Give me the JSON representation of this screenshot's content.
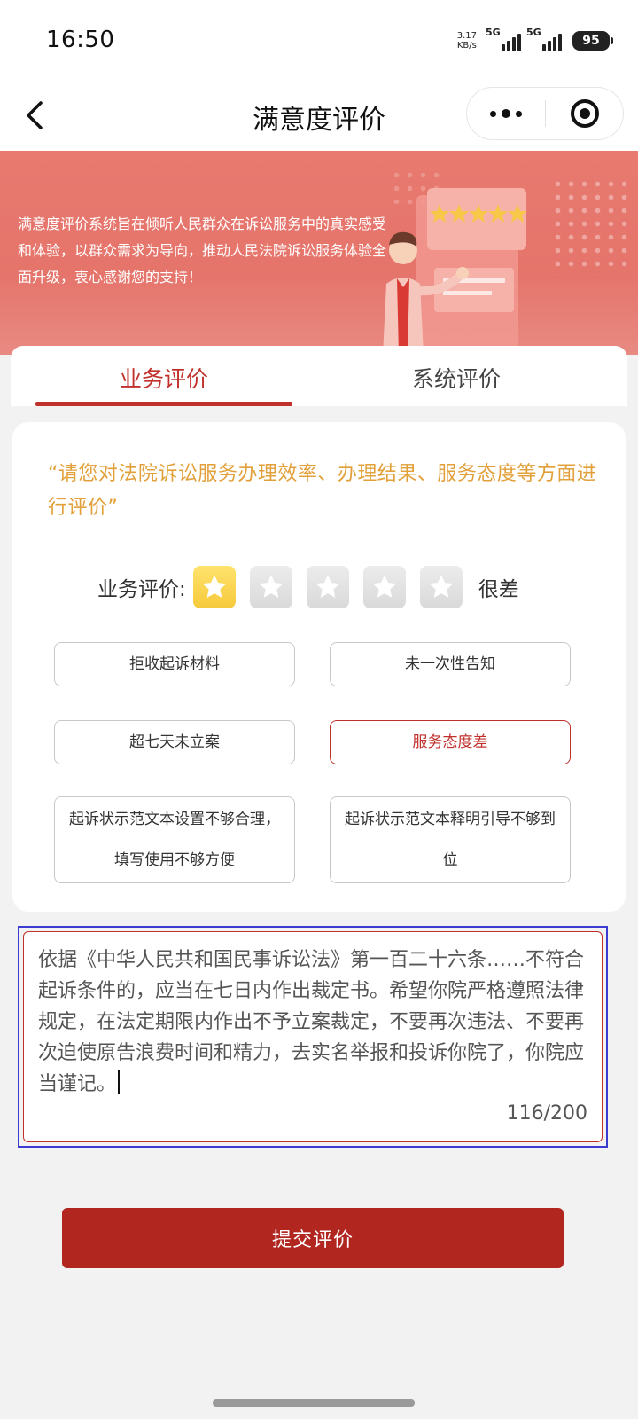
{
  "status_bar": {
    "time": "16:50",
    "net_speed_value": "3.17",
    "net_speed_unit": "KB/s",
    "sim1_label": "5G",
    "sim2_label": "5G",
    "battery": "95"
  },
  "nav": {
    "title": "满意度评价",
    "back_icon": "chevron-left-icon",
    "more_icon": "more-dots-icon",
    "close_icon": "target-circle-icon"
  },
  "banner": {
    "text": "满意度评价系统旨在倾听人民群众在诉讼服务中的真实感受和体验，以群众需求为导向，推动人民法院诉讼服务体验全面升级，衷心感谢您的支持！"
  },
  "tabs": [
    {
      "label": "业务评价",
      "active": true
    },
    {
      "label": "系统评价",
      "active": false
    }
  ],
  "evaluation": {
    "prompt": "“请您对法院诉讼服务办理效率、办理结果、服务态度等方面进行评价”",
    "rating_label": "业务评价:",
    "rating_value": 1,
    "rating_max": 5,
    "rating_text": "很差",
    "tags": [
      {
        "label": "拒收起诉材料",
        "selected": false
      },
      {
        "label": "未一次性告知",
        "selected": false
      },
      {
        "label": "超七天未立案",
        "selected": false
      },
      {
        "label": "服务态度差",
        "selected": true
      },
      {
        "label": "起诉状示范文本设置不够合理，填写使用不够方便",
        "selected": false
      },
      {
        "label": "起诉状示范文本释明引导不够到位",
        "selected": false
      }
    ],
    "comment": "依据《中华人民共和国民事诉讼法》第一百二十六条……不符合起诉条件的，应当在七日内作出裁定书。希望你院严格遵照法律规定，在法定期限内作出不予立案裁定，不要再次违法、不要再次迫使原告浪费时间和精力，去实名举报和投诉你院了，你院应当谨记。",
    "counter": "116/200"
  },
  "submit_label": "提交评价",
  "colors": {
    "primary": "#c0312c",
    "submit": "#b1261f",
    "banner": "#e5746b",
    "prompt": "#e2a03a",
    "star_on": "#f6c93a"
  }
}
